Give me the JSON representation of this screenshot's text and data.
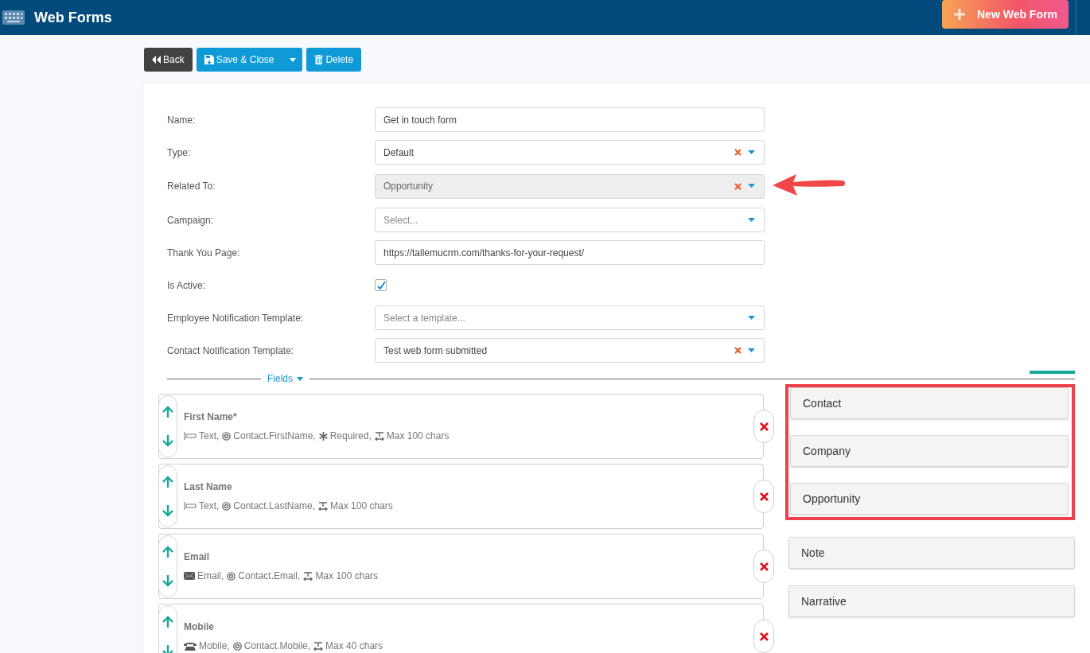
{
  "header": {
    "title": "Web Forms",
    "new_button": "New Web Form"
  },
  "toolbar": {
    "back": "Back",
    "save": "Save & Close",
    "delete": "Delete"
  },
  "form": [
    {
      "kind": "text",
      "label": "Name:",
      "value": "Get in touch form"
    },
    {
      "kind": "select",
      "label": "Type:",
      "value": "Default",
      "clearable": true,
      "disabled": false,
      "annotated": false
    },
    {
      "kind": "select",
      "label": "Related To:",
      "value": "Opportunity",
      "clearable": true,
      "disabled": true,
      "annotated": true
    },
    {
      "kind": "select",
      "label": "Campaign:",
      "placeholder": "Select...",
      "clearable": false,
      "disabled": false,
      "annotated": false
    },
    {
      "kind": "text",
      "label": "Thank You Page:",
      "value": "https://tallemucrm.com/thanks-for-your-request/"
    },
    {
      "kind": "checkbox",
      "label": "Is Active:",
      "checked": true
    },
    {
      "kind": "select",
      "label": "Employee Notification Template:",
      "placeholder": "Select a template...",
      "clearable": false,
      "disabled": false,
      "annotated": false
    },
    {
      "kind": "select",
      "label": "Contact Notification Template:",
      "value": "Test web form submitted",
      "clearable": true,
      "disabled": false,
      "annotated": false
    }
  ],
  "fields_section": {
    "title": "Fields"
  },
  "fields": [
    {
      "label": "First Name*",
      "parts": [
        {
          "kind": "input",
          "text": "Text,"
        },
        {
          "kind": "target",
          "text": "Contact.FirstName,"
        },
        {
          "kind": "asterisk",
          "text": "Required,"
        },
        {
          "kind": "length",
          "text": "Max 100 chars"
        }
      ]
    },
    {
      "label": "Last Name",
      "parts": [
        {
          "kind": "input",
          "text": "Text,"
        },
        {
          "kind": "target",
          "text": "Contact.LastName,"
        },
        {
          "kind": "length",
          "text": "Max 100 chars"
        }
      ]
    },
    {
      "label": "Email",
      "parts": [
        {
          "kind": "envelope",
          "text": "Email,"
        },
        {
          "kind": "target",
          "text": "Contact.Email,"
        },
        {
          "kind": "length",
          "text": "Max 100 chars"
        }
      ]
    },
    {
      "label": "Mobile",
      "parts": [
        {
          "kind": "phone",
          "text": "Mobile,"
        },
        {
          "kind": "target",
          "text": "Contact.Mobile,"
        },
        {
          "kind": "length",
          "text": "Max 40 chars"
        }
      ]
    }
  ],
  "entity_groups": [
    {
      "highlighted": true,
      "items": [
        "Contact",
        "Company",
        "Opportunity"
      ]
    },
    {
      "highlighted": false,
      "items": [
        "Note",
        "Narrative"
      ]
    }
  ]
}
